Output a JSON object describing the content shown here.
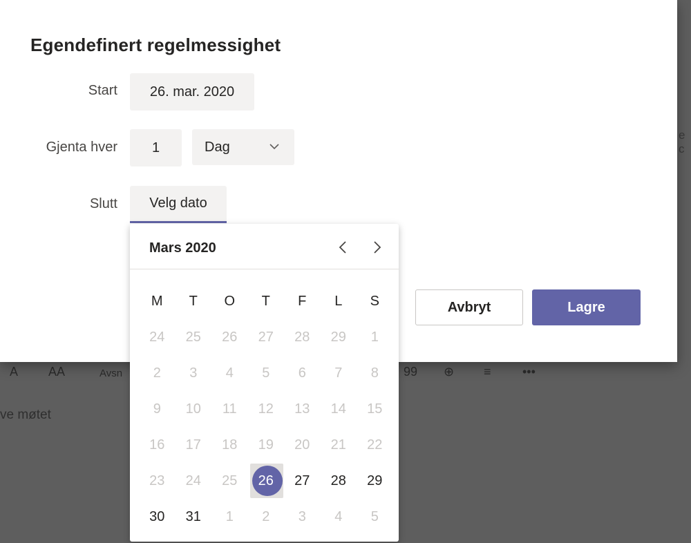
{
  "background": {
    "toolbar_items": [
      "A",
      "AA",
      "Avsn",
      "99",
      "⊕",
      "≡",
      "•••"
    ],
    "body_text": "ve møtet",
    "right_text": "e c"
  },
  "dialog": {
    "title": "Egendefinert regelmessighet",
    "start_label": "Start",
    "start_value": "26. mar. 2020",
    "repeat_label": "Gjenta hver",
    "repeat_count": "1",
    "repeat_unit": "Dag",
    "end_label": "Slutt",
    "end_placeholder": "Velg dato",
    "cancel_label": "Avbryt",
    "save_label": "Lagre"
  },
  "calendar": {
    "month_label": "Mars 2020",
    "weekdays": [
      "M",
      "T",
      "O",
      "T",
      "F",
      "L",
      "S"
    ],
    "weeks": [
      [
        {
          "d": "24",
          "m": true
        },
        {
          "d": "25",
          "m": true
        },
        {
          "d": "26",
          "m": true
        },
        {
          "d": "27",
          "m": true
        },
        {
          "d": "28",
          "m": true
        },
        {
          "d": "29",
          "m": true
        },
        {
          "d": "1",
          "m": true
        }
      ],
      [
        {
          "d": "2",
          "m": true
        },
        {
          "d": "3",
          "m": true
        },
        {
          "d": "4",
          "m": true
        },
        {
          "d": "5",
          "m": true
        },
        {
          "d": "6",
          "m": true
        },
        {
          "d": "7",
          "m": true
        },
        {
          "d": "8",
          "m": true
        }
      ],
      [
        {
          "d": "9",
          "m": true
        },
        {
          "d": "10",
          "m": true
        },
        {
          "d": "11",
          "m": true
        },
        {
          "d": "12",
          "m": true
        },
        {
          "d": "13",
          "m": true
        },
        {
          "d": "14",
          "m": true
        },
        {
          "d": "15",
          "m": true
        }
      ],
      [
        {
          "d": "16",
          "m": true
        },
        {
          "d": "17",
          "m": true
        },
        {
          "d": "18",
          "m": true
        },
        {
          "d": "19",
          "m": true
        },
        {
          "d": "20",
          "m": true
        },
        {
          "d": "21",
          "m": true
        },
        {
          "d": "22",
          "m": true
        }
      ],
      [
        {
          "d": "23",
          "m": true
        },
        {
          "d": "24",
          "m": true
        },
        {
          "d": "25",
          "m": true
        },
        {
          "d": "26",
          "m": false,
          "today": true
        },
        {
          "d": "27",
          "m": false
        },
        {
          "d": "28",
          "m": false
        },
        {
          "d": "29",
          "m": false
        }
      ],
      [
        {
          "d": "30",
          "m": false
        },
        {
          "d": "31",
          "m": false
        },
        {
          "d": "1",
          "m": true
        },
        {
          "d": "2",
          "m": true
        },
        {
          "d": "3",
          "m": true
        },
        {
          "d": "4",
          "m": true
        },
        {
          "d": "5",
          "m": true
        }
      ]
    ]
  },
  "colors": {
    "accent": "#6264a7",
    "field_bg": "#f3f2f1",
    "muted_text": "#c8c6c4"
  }
}
